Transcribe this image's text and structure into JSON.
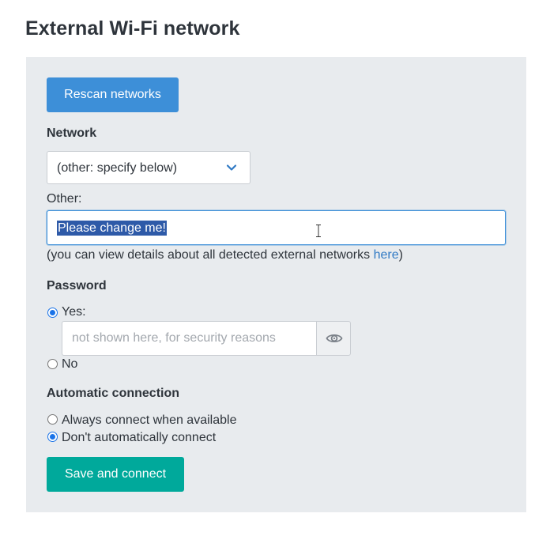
{
  "page": {
    "title": "External Wi-Fi network"
  },
  "actions": {
    "rescan_label": "Rescan networks",
    "save_label": "Save and connect"
  },
  "network": {
    "label": "Network",
    "selected": "(other: specify below)",
    "other_label": "Other:",
    "other_value": "Please change me!",
    "hint_prefix": "(you can view details about all detected external networks ",
    "hint_link": "here",
    "hint_suffix": ")"
  },
  "password": {
    "label": "Password",
    "yes_label": "Yes:",
    "yes_checked": true,
    "placeholder": "not shown here, for security reasons",
    "no_label": "No",
    "no_checked": false,
    "toggle_icon": "eye-icon"
  },
  "auto_connection": {
    "label": "Automatic connection",
    "always_label": "Always connect when available",
    "always_checked": false,
    "never_label": "Don't automatically connect",
    "never_checked": true
  },
  "colors": {
    "rescan_button": "#3d8fd8",
    "save_button": "#00a99b",
    "panel_background": "#e8ebee",
    "link": "#2f79c4",
    "selection": "#2e5aa8"
  }
}
